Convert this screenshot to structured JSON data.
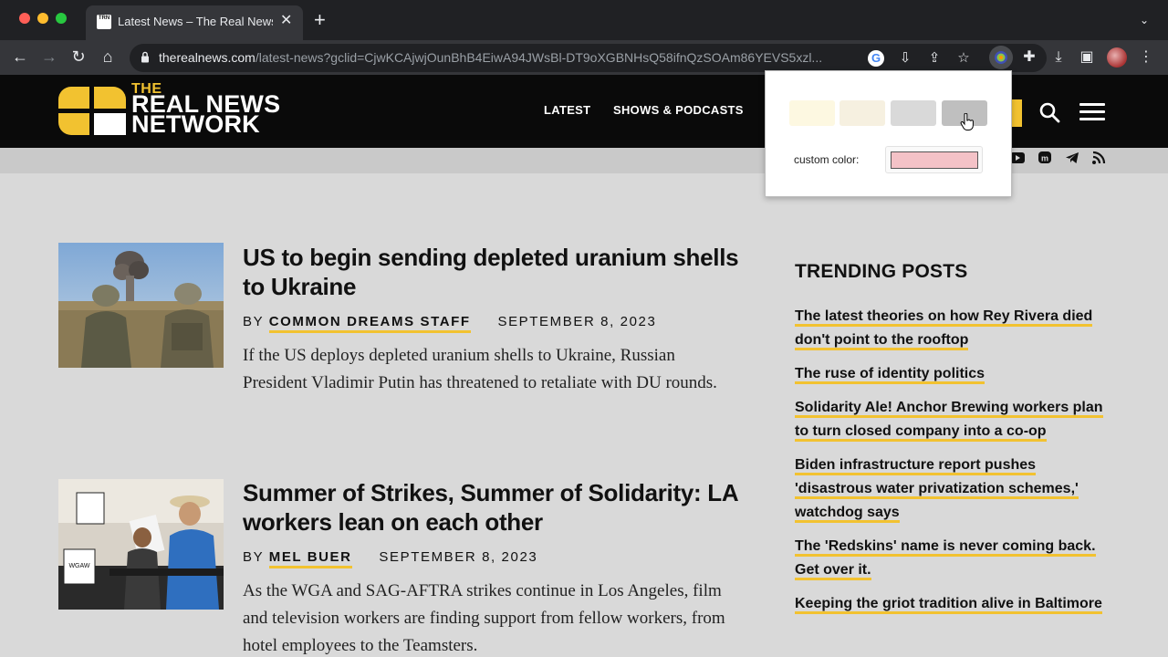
{
  "colors": {
    "brand_yellow": "#f2c230",
    "page_bg": "#d9d9d9",
    "header_bg": "#0a0a0a"
  },
  "browser": {
    "tab_favicon_text": "TRN",
    "tab_title": "Latest News – The Real News Network",
    "tab_close": "✕",
    "new_tab": "+",
    "tab_menu": "⌄",
    "url_host": "therealnews.com",
    "url_path": "/latest-news?gclid=CjwKCAjwjOunBhB4EiwA94JWsBl-DT9oXGBNHsQ58ifnQzSOAm86YEVS5xzl...",
    "icons": [
      "back-icon",
      "forward-icon",
      "reload-icon",
      "home-icon",
      "google-icon",
      "install-icon",
      "share-icon",
      "star-icon",
      "extension-colorpicker-icon",
      "puzzle-icon",
      "download-icon",
      "sidepanel-icon",
      "profile-avatar",
      "kebab-menu-icon"
    ]
  },
  "site": {
    "logo_the": "THE",
    "logo_line1": "REAL NEWS",
    "logo_line2": "NETWORK",
    "nav": {
      "latest": "LATEST",
      "shows": "SHOWS & PODCASTS"
    },
    "social_icons": [
      "youtube-icon",
      "mastodon-icon",
      "telegram-icon",
      "rss-icon"
    ]
  },
  "articles": [
    {
      "title": "US to begin sending depleted uranium shells to Ukraine",
      "by": "BY",
      "author": "COMMON DREAMS STAFF",
      "date": "SEPTEMBER 8, 2023",
      "excerpt": "If the US deploys depleted uranium shells to Ukraine, Russian President Vladimir Putin has threatened to retaliate with DU rounds."
    },
    {
      "title": "Summer of Strikes, Summer of Solidarity: LA workers lean on each other",
      "by": "BY",
      "author": "MEL BUER",
      "date": "SEPTEMBER 8, 2023",
      "excerpt": "As the WGA and SAG-AFTRA strikes continue in Los Angeles, film and television workers are finding support from fellow workers, from hotel employees to the Teamsters."
    }
  ],
  "trending": {
    "title": "TRENDING POSTS",
    "items": [
      "The latest theories on how Rey Rivera died don't point to the rooftop",
      "The ruse of identity politics",
      "Solidarity Ale! Anchor Brewing workers plan to turn closed company into a co-op",
      "Biden infrastructure report pushes 'disastrous water privatization schemes,' watchdog says",
      "The 'Redskins' name is never coming back. Get over it.",
      "Keeping the griot tradition alive in Baltimore"
    ]
  },
  "color_picker": {
    "swatches": [
      "#fdf8e1",
      "#f6f0e0",
      "#d9d9d9",
      "#bfbfbf"
    ],
    "custom_label": "custom color:",
    "custom_value": "#f4c2c7"
  }
}
